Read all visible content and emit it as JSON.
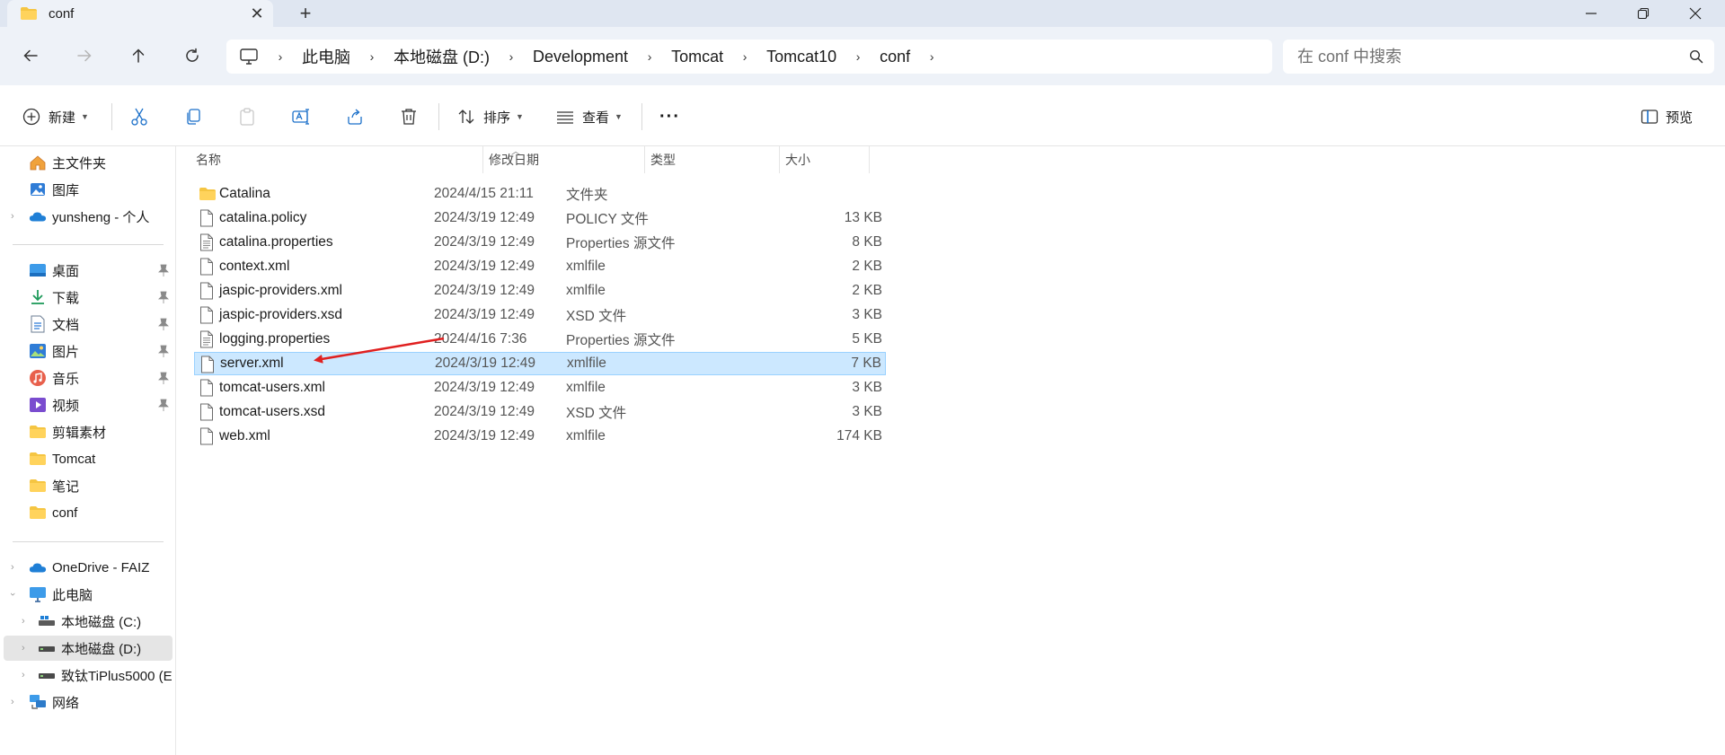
{
  "tab": {
    "title": "conf",
    "close_glyph": "✕",
    "new_glyph": "+"
  },
  "window": {
    "minimize_glyph": "—",
    "restore_glyph": "❐",
    "close_glyph": "✕"
  },
  "address": {
    "breadcrumbs": [
      "此电脑",
      "本地磁盘 (D:)",
      "Development",
      "Tomcat",
      "Tomcat10",
      "conf"
    ],
    "separator": "›"
  },
  "search": {
    "placeholder": "在 conf 中搜索"
  },
  "toolbar": {
    "new_label": "新建",
    "sort_label": "排序",
    "view_label": "查看",
    "more_label": "···",
    "preview_label": "预览"
  },
  "sidebar": {
    "top": [
      {
        "label": "主文件夹",
        "icon": "home-icon"
      },
      {
        "label": "图库",
        "icon": "gallery-icon"
      },
      {
        "label": "yunsheng - 个人",
        "icon": "onedrive-icon"
      }
    ],
    "quick": [
      {
        "label": "桌面",
        "icon": "desktop-icon",
        "pinned": true
      },
      {
        "label": "下载",
        "icon": "download-icon",
        "pinned": true
      },
      {
        "label": "文档",
        "icon": "documents-icon",
        "pinned": true
      },
      {
        "label": "图片",
        "icon": "pictures-icon",
        "pinned": true
      },
      {
        "label": "音乐",
        "icon": "music-icon",
        "pinned": true
      },
      {
        "label": "视频",
        "icon": "videos-icon",
        "pinned": true
      },
      {
        "label": "剪辑素材",
        "icon": "folder-icon",
        "pinned": false
      },
      {
        "label": "Tomcat",
        "icon": "folder-icon",
        "pinned": false
      },
      {
        "label": "笔记",
        "icon": "folder-icon",
        "pinned": false
      },
      {
        "label": "conf",
        "icon": "folder-icon",
        "pinned": false
      }
    ],
    "devices": [
      {
        "label": "OneDrive - FAIZ",
        "icon": "onedrive-icon"
      },
      {
        "label": "此电脑",
        "icon": "pc-icon"
      },
      {
        "label": "本地磁盘 (C:)",
        "icon": "drive-icon"
      },
      {
        "label": "本地磁盘 (D:)",
        "icon": "drive-icon",
        "selected": true
      },
      {
        "label": "致钛TiPlus5000 (E",
        "icon": "drive-icon"
      },
      {
        "label": "网络",
        "icon": "network-icon"
      }
    ]
  },
  "columns": {
    "name": "名称",
    "date": "修改日期",
    "type": "类型",
    "size": "大小"
  },
  "files": [
    {
      "name": "Catalina",
      "date": "2024/4/15 21:11",
      "type": "文件夹",
      "size": "",
      "kind": "folder"
    },
    {
      "name": "catalina.policy",
      "date": "2024/3/19 12:49",
      "type": "POLICY 文件",
      "size": "13 KB",
      "kind": "file"
    },
    {
      "name": "catalina.properties",
      "date": "2024/3/19 12:49",
      "type": "Properties 源文件",
      "size": "8 KB",
      "kind": "text"
    },
    {
      "name": "context.xml",
      "date": "2024/3/19 12:49",
      "type": "xmlfile",
      "size": "2 KB",
      "kind": "file"
    },
    {
      "name": "jaspic-providers.xml",
      "date": "2024/3/19 12:49",
      "type": "xmlfile",
      "size": "2 KB",
      "kind": "file"
    },
    {
      "name": "jaspic-providers.xsd",
      "date": "2024/3/19 12:49",
      "type": "XSD 文件",
      "size": "3 KB",
      "kind": "file"
    },
    {
      "name": "logging.properties",
      "date": "2024/4/16 7:36",
      "type": "Properties 源文件",
      "size": "5 KB",
      "kind": "text"
    },
    {
      "name": "server.xml",
      "date": "2024/3/19 12:49",
      "type": "xmlfile",
      "size": "7 KB",
      "kind": "file",
      "selected": true
    },
    {
      "name": "tomcat-users.xml",
      "date": "2024/3/19 12:49",
      "type": "xmlfile",
      "size": "3 KB",
      "kind": "file"
    },
    {
      "name": "tomcat-users.xsd",
      "date": "2024/3/19 12:49",
      "type": "XSD 文件",
      "size": "3 KB",
      "kind": "file"
    },
    {
      "name": "web.xml",
      "date": "2024/3/19 12:49",
      "type": "xmlfile",
      "size": "174 KB",
      "kind": "file"
    }
  ],
  "colors": {
    "accent": "#0067c0",
    "selection_fill": "#cce8ff",
    "selection_border": "#99d1ff",
    "folder": "#f5c542",
    "annotation_arrow": "#e02020"
  }
}
